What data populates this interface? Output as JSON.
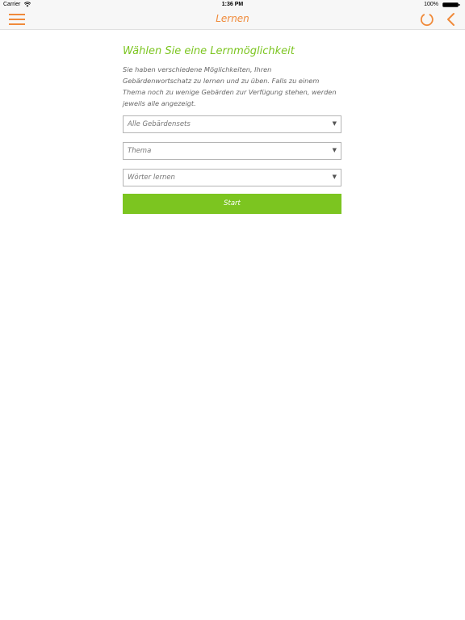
{
  "status_bar": {
    "carrier": "Carrier",
    "time": "1:36 PM",
    "battery": "100%"
  },
  "nav": {
    "title": "Lernen",
    "accent_color": "#f08a3a",
    "icons": [
      "menu-icon",
      "refresh-icon",
      "back-icon"
    ]
  },
  "main": {
    "heading": "Wählen Sie eine Lernmöglichkeit",
    "description": "Sie haben verschiedene Möglichkeiten, Ihren Gebärdenwortschatz zu lernen und zu üben. Falls zu einem Thema noch zu wenige Gebärden zur Verfügung stehen, werden jeweils alle angezeigt.",
    "selects": [
      {
        "value": "Alle Gebärdensets"
      },
      {
        "value": "Thema"
      },
      {
        "value": "Wörter lernen"
      }
    ],
    "start_label": "Start",
    "accent_color": "#7cc520"
  }
}
